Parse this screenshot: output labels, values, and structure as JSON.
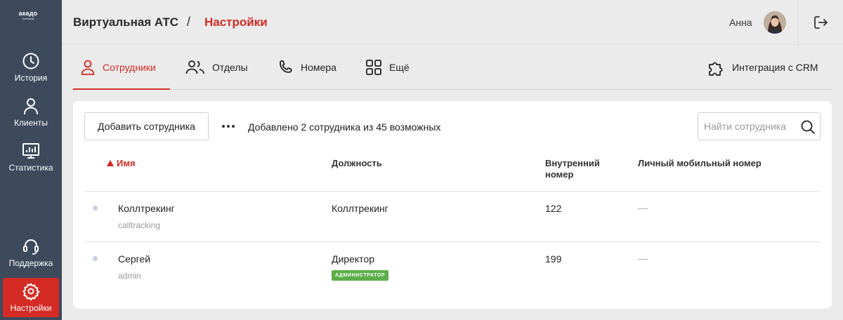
{
  "brand": {
    "logo_main": "акадо",
    "logo_sub": "телеком"
  },
  "sidebar": {
    "items": [
      {
        "label": "История",
        "icon": "clock-icon"
      },
      {
        "label": "Клиенты",
        "icon": "person-icon"
      },
      {
        "label": "Статистика",
        "icon": "monitor-chart-icon"
      },
      {
        "label": "Поддержка",
        "icon": "headset-icon"
      },
      {
        "label": "Настройки",
        "icon": "gear-icon",
        "active": true
      }
    ]
  },
  "header": {
    "breadcrumb_root": "Виртуальная АТС",
    "breadcrumb_separator": "/",
    "breadcrumb_current": "Настройки",
    "user_name": "Анна"
  },
  "tabs": {
    "items": [
      {
        "label": "Сотрудники",
        "icon": "employee-icon",
        "active": true
      },
      {
        "label": "Отделы",
        "icon": "group-icon"
      },
      {
        "label": "Номера",
        "icon": "phone-icon"
      },
      {
        "label": "Ещё",
        "icon": "grid-icon"
      }
    ],
    "crm_label": "Интеграция с CRM"
  },
  "toolbar": {
    "add_button": "Добавить сотрудника",
    "added_text": "Добавлено 2 сотрудника из 45 возможных",
    "search_placeholder": "Найти сотрудника"
  },
  "table": {
    "headers": {
      "name": "Имя",
      "position": "Должность",
      "internal_line1": "Внутренний",
      "internal_line2": "номер",
      "mobile": "Личный мобильный номер"
    },
    "rows": [
      {
        "name": "Коллтрекинг",
        "login": "calltracking",
        "position": "Коллтрекинг",
        "badge": "",
        "internal": "122",
        "mobile": "—"
      },
      {
        "name": "Сергей",
        "login": "admin",
        "position": "Директор",
        "badge": "АДМИНИСТРАТОР",
        "internal": "199",
        "mobile": "—"
      }
    ]
  },
  "colors": {
    "accent": "#d42b24",
    "sidebar": "#3d4a5c",
    "badge": "#5cae4a"
  }
}
